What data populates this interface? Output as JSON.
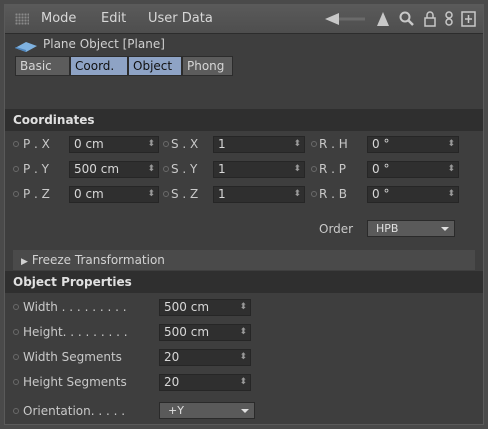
{
  "menu": {
    "mode": "Mode",
    "edit": "Edit",
    "user_data": "User Data"
  },
  "object": {
    "title": "Plane Object [Plane]"
  },
  "tabs": [
    {
      "label": "Basic",
      "active": false
    },
    {
      "label": "Coord.",
      "active": true
    },
    {
      "label": "Object",
      "active": true
    },
    {
      "label": "Phong",
      "active": false
    }
  ],
  "coordinates": {
    "header": "Coordinates",
    "rows": [
      {
        "p_label": "P . X",
        "p_value": "0 cm",
        "s_label": "S . X",
        "s_value": "1",
        "r_label": "R . H",
        "r_value": "0 °"
      },
      {
        "p_label": "P . Y",
        "p_value": "500 cm",
        "s_label": "S . Y",
        "s_value": "1",
        "r_label": "R . P",
        "r_value": "0 °"
      },
      {
        "p_label": "P . Z",
        "p_value": "0 cm",
        "s_label": "S . Z",
        "s_value": "1",
        "r_label": "R . B",
        "r_value": "0 °"
      }
    ],
    "order_label": "Order",
    "order_value": "HPB",
    "freeze": "Freeze Transformation"
  },
  "object_properties": {
    "header": "Object Properties",
    "width_label": "Width . . . . . . . . .",
    "width_value": "500 cm",
    "height_label": "Height. . . . . . . . .",
    "height_value": "500 cm",
    "wseg_label": "Width Segments",
    "wseg_value": "20",
    "hseg_label": "Height Segments",
    "hseg_value": "20",
    "orient_label": "Orientation. . . . .",
    "orient_value": "+Y"
  },
  "colors": {
    "tab_active": "#8ea3c5",
    "section_bg": "#2f2f2f",
    "panel_bg": "#3e3e3e"
  }
}
